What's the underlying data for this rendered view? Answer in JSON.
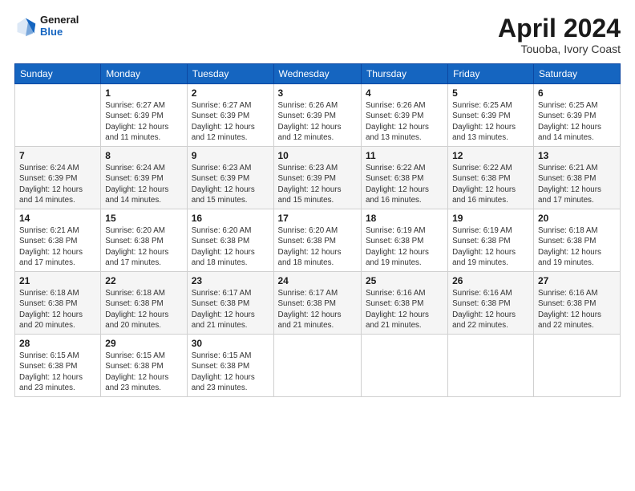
{
  "header": {
    "logo": {
      "line1": "General",
      "line2": "Blue"
    },
    "title": "April 2024",
    "location": "Touoba, Ivory Coast"
  },
  "weekdays": [
    "Sunday",
    "Monday",
    "Tuesday",
    "Wednesday",
    "Thursday",
    "Friday",
    "Saturday"
  ],
  "weeks": [
    [
      {
        "day": "",
        "detail": ""
      },
      {
        "day": "1",
        "detail": "Sunrise: 6:27 AM\nSunset: 6:39 PM\nDaylight: 12 hours\nand 11 minutes."
      },
      {
        "day": "2",
        "detail": "Sunrise: 6:27 AM\nSunset: 6:39 PM\nDaylight: 12 hours\nand 12 minutes."
      },
      {
        "day": "3",
        "detail": "Sunrise: 6:26 AM\nSunset: 6:39 PM\nDaylight: 12 hours\nand 12 minutes."
      },
      {
        "day": "4",
        "detail": "Sunrise: 6:26 AM\nSunset: 6:39 PM\nDaylight: 12 hours\nand 13 minutes."
      },
      {
        "day": "5",
        "detail": "Sunrise: 6:25 AM\nSunset: 6:39 PM\nDaylight: 12 hours\nand 13 minutes."
      },
      {
        "day": "6",
        "detail": "Sunrise: 6:25 AM\nSunset: 6:39 PM\nDaylight: 12 hours\nand 14 minutes."
      }
    ],
    [
      {
        "day": "7",
        "detail": "Sunrise: 6:24 AM\nSunset: 6:39 PM\nDaylight: 12 hours\nand 14 minutes."
      },
      {
        "day": "8",
        "detail": "Sunrise: 6:24 AM\nSunset: 6:39 PM\nDaylight: 12 hours\nand 14 minutes."
      },
      {
        "day": "9",
        "detail": "Sunrise: 6:23 AM\nSunset: 6:39 PM\nDaylight: 12 hours\nand 15 minutes."
      },
      {
        "day": "10",
        "detail": "Sunrise: 6:23 AM\nSunset: 6:39 PM\nDaylight: 12 hours\nand 15 minutes."
      },
      {
        "day": "11",
        "detail": "Sunrise: 6:22 AM\nSunset: 6:38 PM\nDaylight: 12 hours\nand 16 minutes."
      },
      {
        "day": "12",
        "detail": "Sunrise: 6:22 AM\nSunset: 6:38 PM\nDaylight: 12 hours\nand 16 minutes."
      },
      {
        "day": "13",
        "detail": "Sunrise: 6:21 AM\nSunset: 6:38 PM\nDaylight: 12 hours\nand 17 minutes."
      }
    ],
    [
      {
        "day": "14",
        "detail": "Sunrise: 6:21 AM\nSunset: 6:38 PM\nDaylight: 12 hours\nand 17 minutes."
      },
      {
        "day": "15",
        "detail": "Sunrise: 6:20 AM\nSunset: 6:38 PM\nDaylight: 12 hours\nand 17 minutes."
      },
      {
        "day": "16",
        "detail": "Sunrise: 6:20 AM\nSunset: 6:38 PM\nDaylight: 12 hours\nand 18 minutes."
      },
      {
        "day": "17",
        "detail": "Sunrise: 6:20 AM\nSunset: 6:38 PM\nDaylight: 12 hours\nand 18 minutes."
      },
      {
        "day": "18",
        "detail": "Sunrise: 6:19 AM\nSunset: 6:38 PM\nDaylight: 12 hours\nand 19 minutes."
      },
      {
        "day": "19",
        "detail": "Sunrise: 6:19 AM\nSunset: 6:38 PM\nDaylight: 12 hours\nand 19 minutes."
      },
      {
        "day": "20",
        "detail": "Sunrise: 6:18 AM\nSunset: 6:38 PM\nDaylight: 12 hours\nand 19 minutes."
      }
    ],
    [
      {
        "day": "21",
        "detail": "Sunrise: 6:18 AM\nSunset: 6:38 PM\nDaylight: 12 hours\nand 20 minutes."
      },
      {
        "day": "22",
        "detail": "Sunrise: 6:18 AM\nSunset: 6:38 PM\nDaylight: 12 hours\nand 20 minutes."
      },
      {
        "day": "23",
        "detail": "Sunrise: 6:17 AM\nSunset: 6:38 PM\nDaylight: 12 hours\nand 21 minutes."
      },
      {
        "day": "24",
        "detail": "Sunrise: 6:17 AM\nSunset: 6:38 PM\nDaylight: 12 hours\nand 21 minutes."
      },
      {
        "day": "25",
        "detail": "Sunrise: 6:16 AM\nSunset: 6:38 PM\nDaylight: 12 hours\nand 21 minutes."
      },
      {
        "day": "26",
        "detail": "Sunrise: 6:16 AM\nSunset: 6:38 PM\nDaylight: 12 hours\nand 22 minutes."
      },
      {
        "day": "27",
        "detail": "Sunrise: 6:16 AM\nSunset: 6:38 PM\nDaylight: 12 hours\nand 22 minutes."
      }
    ],
    [
      {
        "day": "28",
        "detail": "Sunrise: 6:15 AM\nSunset: 6:38 PM\nDaylight: 12 hours\nand 23 minutes."
      },
      {
        "day": "29",
        "detail": "Sunrise: 6:15 AM\nSunset: 6:38 PM\nDaylight: 12 hours\nand 23 minutes."
      },
      {
        "day": "30",
        "detail": "Sunrise: 6:15 AM\nSunset: 6:38 PM\nDaylight: 12 hours\nand 23 minutes."
      },
      {
        "day": "",
        "detail": ""
      },
      {
        "day": "",
        "detail": ""
      },
      {
        "day": "",
        "detail": ""
      },
      {
        "day": "",
        "detail": ""
      }
    ]
  ]
}
